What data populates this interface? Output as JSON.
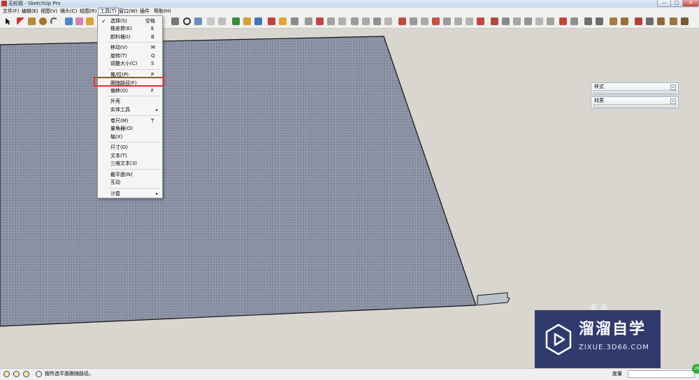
{
  "window": {
    "title": "无标题 - SketchUp Pro",
    "minimize": "—",
    "maximize": "□",
    "close": "✕"
  },
  "menubar": {
    "items": [
      "文件(F)",
      "编辑(E)",
      "视图(V)",
      "镜头(C)",
      "绘图(R)",
      "工具(T)",
      "窗口(W)",
      "插件",
      "帮助(H)"
    ],
    "active_index": 5
  },
  "tools_menu": {
    "items": [
      {
        "label": "选择(S)",
        "shortcut": "空格",
        "checked": true
      },
      {
        "label": "橡皮擦(E)",
        "shortcut": "E"
      },
      {
        "label": "颜料桶(I)",
        "shortcut": "B"
      },
      {
        "label": "移动(V)",
        "shortcut": "M"
      },
      {
        "label": "旋转(T)",
        "shortcut": "Q"
      },
      {
        "label": "调整大小(C)",
        "shortcut": "S"
      },
      {
        "label": "推/拉(P)",
        "shortcut": "P"
      },
      {
        "label": "跟随路径(F)",
        "shortcut": "",
        "highlighted": true
      },
      {
        "label": "偏移(O)",
        "shortcut": "F"
      },
      {
        "label": "外壳",
        "shortcut": ""
      },
      {
        "label": "实体工具",
        "shortcut": "",
        "submenu": true
      },
      {
        "label": "卷尺(M)",
        "shortcut": "T"
      },
      {
        "label": "量角器(O)",
        "shortcut": ""
      },
      {
        "label": "轴(X)",
        "shortcut": ""
      },
      {
        "label": "尺寸(D)",
        "shortcut": ""
      },
      {
        "label": "文本(T)",
        "shortcut": ""
      },
      {
        "label": "三维文本(3)",
        "shortcut": ""
      },
      {
        "label": "截平面(N)",
        "shortcut": ""
      },
      {
        "label": "互动",
        "shortcut": ""
      },
      {
        "label": "沙盒",
        "shortcut": "",
        "submenu": true
      }
    ]
  },
  "trays": [
    {
      "title": "样式"
    },
    {
      "title": "材质"
    }
  ],
  "watermark": {
    "name": "溜溜自学",
    "url": "ZIXUE.3D66.COM"
  },
  "statusbar": {
    "hint": "按所选平面跟随路径。",
    "measure_label": "度量",
    "measure_value": ""
  },
  "corner_badge": "29",
  "colors": {
    "face": "#8f96a8",
    "viewport": "#d8d6cf",
    "highlight_border": "#e0322f",
    "watermark_bg": "#2a3368"
  }
}
